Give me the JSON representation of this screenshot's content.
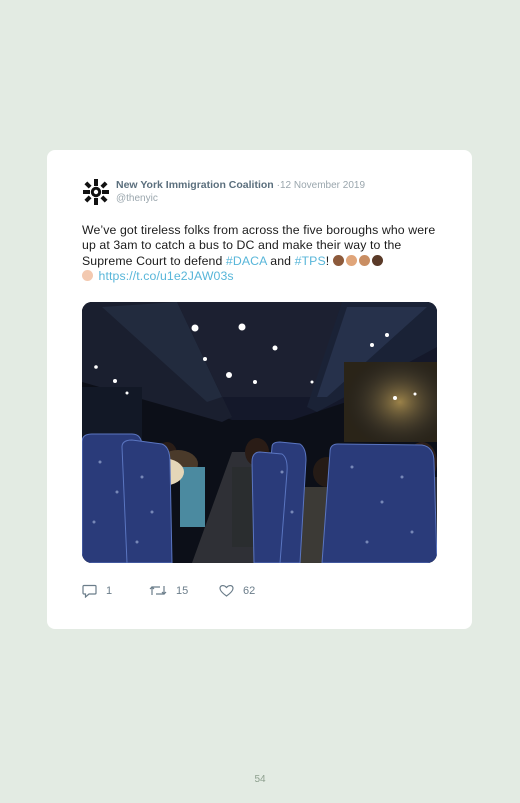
{
  "tweet": {
    "author_name": "New York Immigration Coalition",
    "separator": "·",
    "date": "12 November 2019",
    "handle": "@thenyic",
    "text_part1": "We’ve got tireless folks from across the five boroughs who were up at 3am to catch a bus to DC and make their way to the Supreme Court to defend ",
    "hashtag1": "#DACA",
    "text_and": " and ",
    "hashtag2": "#TPS",
    "text_bang": "! ",
    "link": "https://t.co/u1e2JAW03s",
    "emoji_colors": [
      "#8d5a3b",
      "#e0a57a",
      "#c98e63",
      "#5a3a28"
    ],
    "last_emoji_color": "#f3c9b0"
  },
  "stats": {
    "replies": "1",
    "retweets": "15",
    "likes": "62"
  },
  "icons": {
    "avatar": "nyic-logo-icon",
    "reply": "reply-icon",
    "retweet": "retweet-icon",
    "like": "heart-icon"
  },
  "colors": {
    "background": "#e3ebe3",
    "card": "#ffffff",
    "author": "#5b6f7d",
    "link": "#58b6d9"
  },
  "page_number": "54"
}
